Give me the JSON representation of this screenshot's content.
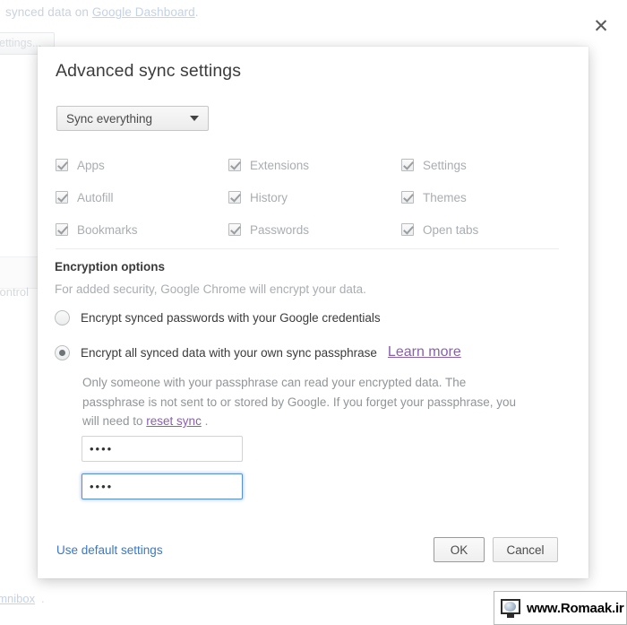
{
  "background": {
    "top_text_prefix": "synced data on ",
    "top_link": "Google Dashboard",
    "top_text_suffix": ".",
    "settings_button": "ettings...",
    "control_text": "control",
    "bottom_link": "omnibox",
    "bottom_dot": "."
  },
  "watermark": {
    "text": "www.Romaak.ir",
    "icon": "globe-monitor-icon"
  },
  "dialog": {
    "title": "Advanced sync settings",
    "close_label": "✕",
    "sync_select": {
      "value": "Sync everything",
      "caret": "chevron-down-icon"
    },
    "datatypes": [
      {
        "label": "Apps",
        "checked": true,
        "disabled": true
      },
      {
        "label": "Extensions",
        "checked": true,
        "disabled": true
      },
      {
        "label": "Settings",
        "checked": true,
        "disabled": true
      },
      {
        "label": "Autofill",
        "checked": true,
        "disabled": true
      },
      {
        "label": "History",
        "checked": true,
        "disabled": true
      },
      {
        "label": "Themes",
        "checked": true,
        "disabled": true
      },
      {
        "label": "Bookmarks",
        "checked": true,
        "disabled": true
      },
      {
        "label": "Passwords",
        "checked": true,
        "disabled": true
      },
      {
        "label": "Open tabs",
        "checked": true,
        "disabled": true
      }
    ],
    "encryption": {
      "heading": "Encryption options",
      "subtext": "For added security, Google Chrome will encrypt your data.",
      "option_google": "Encrypt synced passwords with your Google credentials",
      "option_passphrase": "Encrypt all synced data with your own sync passphrase",
      "learn_more": "Learn more",
      "selected": "passphrase",
      "description_part1": "Only someone with your passphrase can read your encrypted data. The passphrase is not sent to or stored by Google. If you forget your passphrase, you will need to ",
      "reset_sync_link": "reset sync",
      "description_part2": " ."
    },
    "passphrase_field": {
      "value": "••••",
      "placeholder": ""
    },
    "confirm_field": {
      "value": "••••",
      "placeholder": "",
      "focused": true
    },
    "footer": {
      "use_default": "Use default settings",
      "ok": "OK",
      "cancel": "Cancel"
    }
  },
  "colors": {
    "focus_blue": "#5791d4",
    "link_blue": "#3b78c4",
    "visited_purple": "#8a5fb0",
    "disabled_gray": "#a9adb1"
  }
}
